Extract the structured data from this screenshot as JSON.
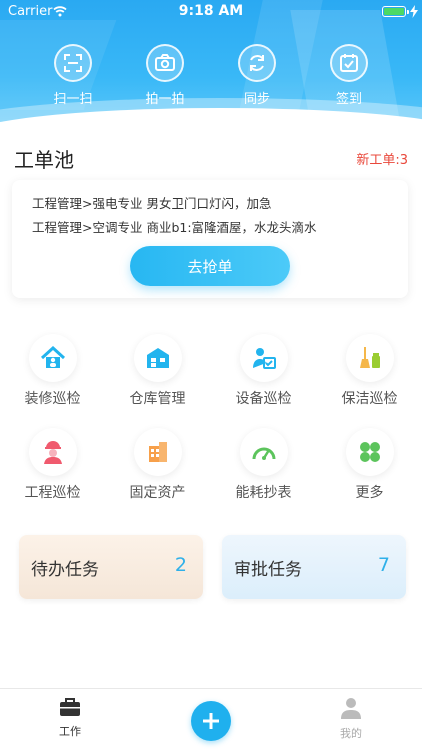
{
  "status_bar": {
    "carrier": "Carrier",
    "time": "9:18 AM",
    "battery_color": "#4cd964"
  },
  "quick_actions": [
    {
      "label": "扫一扫",
      "icon": "scan-icon"
    },
    {
      "label": "拍一拍",
      "icon": "camera-icon"
    },
    {
      "label": "同步",
      "icon": "sync-icon"
    },
    {
      "label": "签到",
      "icon": "calendar-check-icon"
    }
  ],
  "work_pool": {
    "title": "工单池",
    "new_orders": "新工单:3",
    "orders": [
      "工程管理>强电专业 男女卫门口灯闪，加急",
      "工程管理>空调专业 商业b1:富隆酒屋，水龙头滴水"
    ],
    "grab_button": "去抢单"
  },
  "modules": [
    {
      "label": "装修巡检",
      "icon": "house-icon",
      "color": "#22b4ee"
    },
    {
      "label": "仓库管理",
      "icon": "warehouse-icon",
      "color": "#22b4ee"
    },
    {
      "label": "设备巡检",
      "icon": "equipment-inspect-icon",
      "color": "#22b4ee"
    },
    {
      "label": "保洁巡检",
      "icon": "broom-icon",
      "color": "#9acd32"
    },
    {
      "label": "工程巡检",
      "icon": "engineer-icon",
      "color": "#f05a6e"
    },
    {
      "label": "固定资产",
      "icon": "building-icon",
      "color": "#f7a04a"
    },
    {
      "label": "能耗抄表",
      "icon": "gauge-icon",
      "color": "#5cc45c"
    },
    {
      "label": "更多",
      "icon": "clover-icon",
      "color": "#5cc45c"
    }
  ],
  "tasks": {
    "todo": {
      "label": "待办任务",
      "count": "2"
    },
    "approve": {
      "label": "审批任务",
      "count": "7"
    }
  },
  "tabbar": {
    "work": {
      "label": "工作",
      "color": "#333333"
    },
    "add": {
      "icon": "plus-icon",
      "color": "#1fb0ee"
    },
    "mine": {
      "label": "我的",
      "color": "#aaaaaa"
    }
  }
}
